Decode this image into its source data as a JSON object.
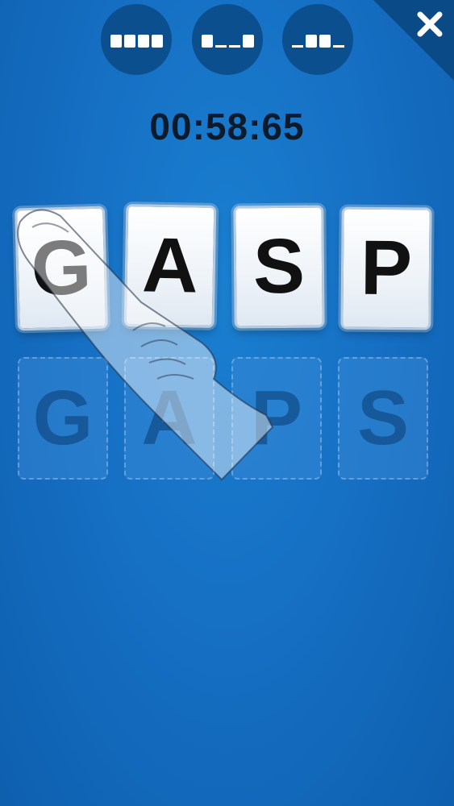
{
  "hints": [
    {
      "slots": [
        true,
        true,
        true,
        true
      ]
    },
    {
      "slots": [
        true,
        false,
        false,
        true
      ]
    },
    {
      "slots": [
        false,
        true,
        true,
        false
      ]
    }
  ],
  "timer": "00:58:65",
  "scrambled_tiles": [
    "G",
    "A",
    "S",
    "P"
  ],
  "target_tiles": [
    "G",
    "A",
    "P",
    "S"
  ],
  "colors": {
    "background": "#1670c4",
    "hint_circle": "#0b4f8e",
    "corner": "#0a4a86",
    "timer_text": "#0b1b2c"
  },
  "icons": {
    "close": "close-icon",
    "tutorial": "pointing-hand-icon"
  }
}
